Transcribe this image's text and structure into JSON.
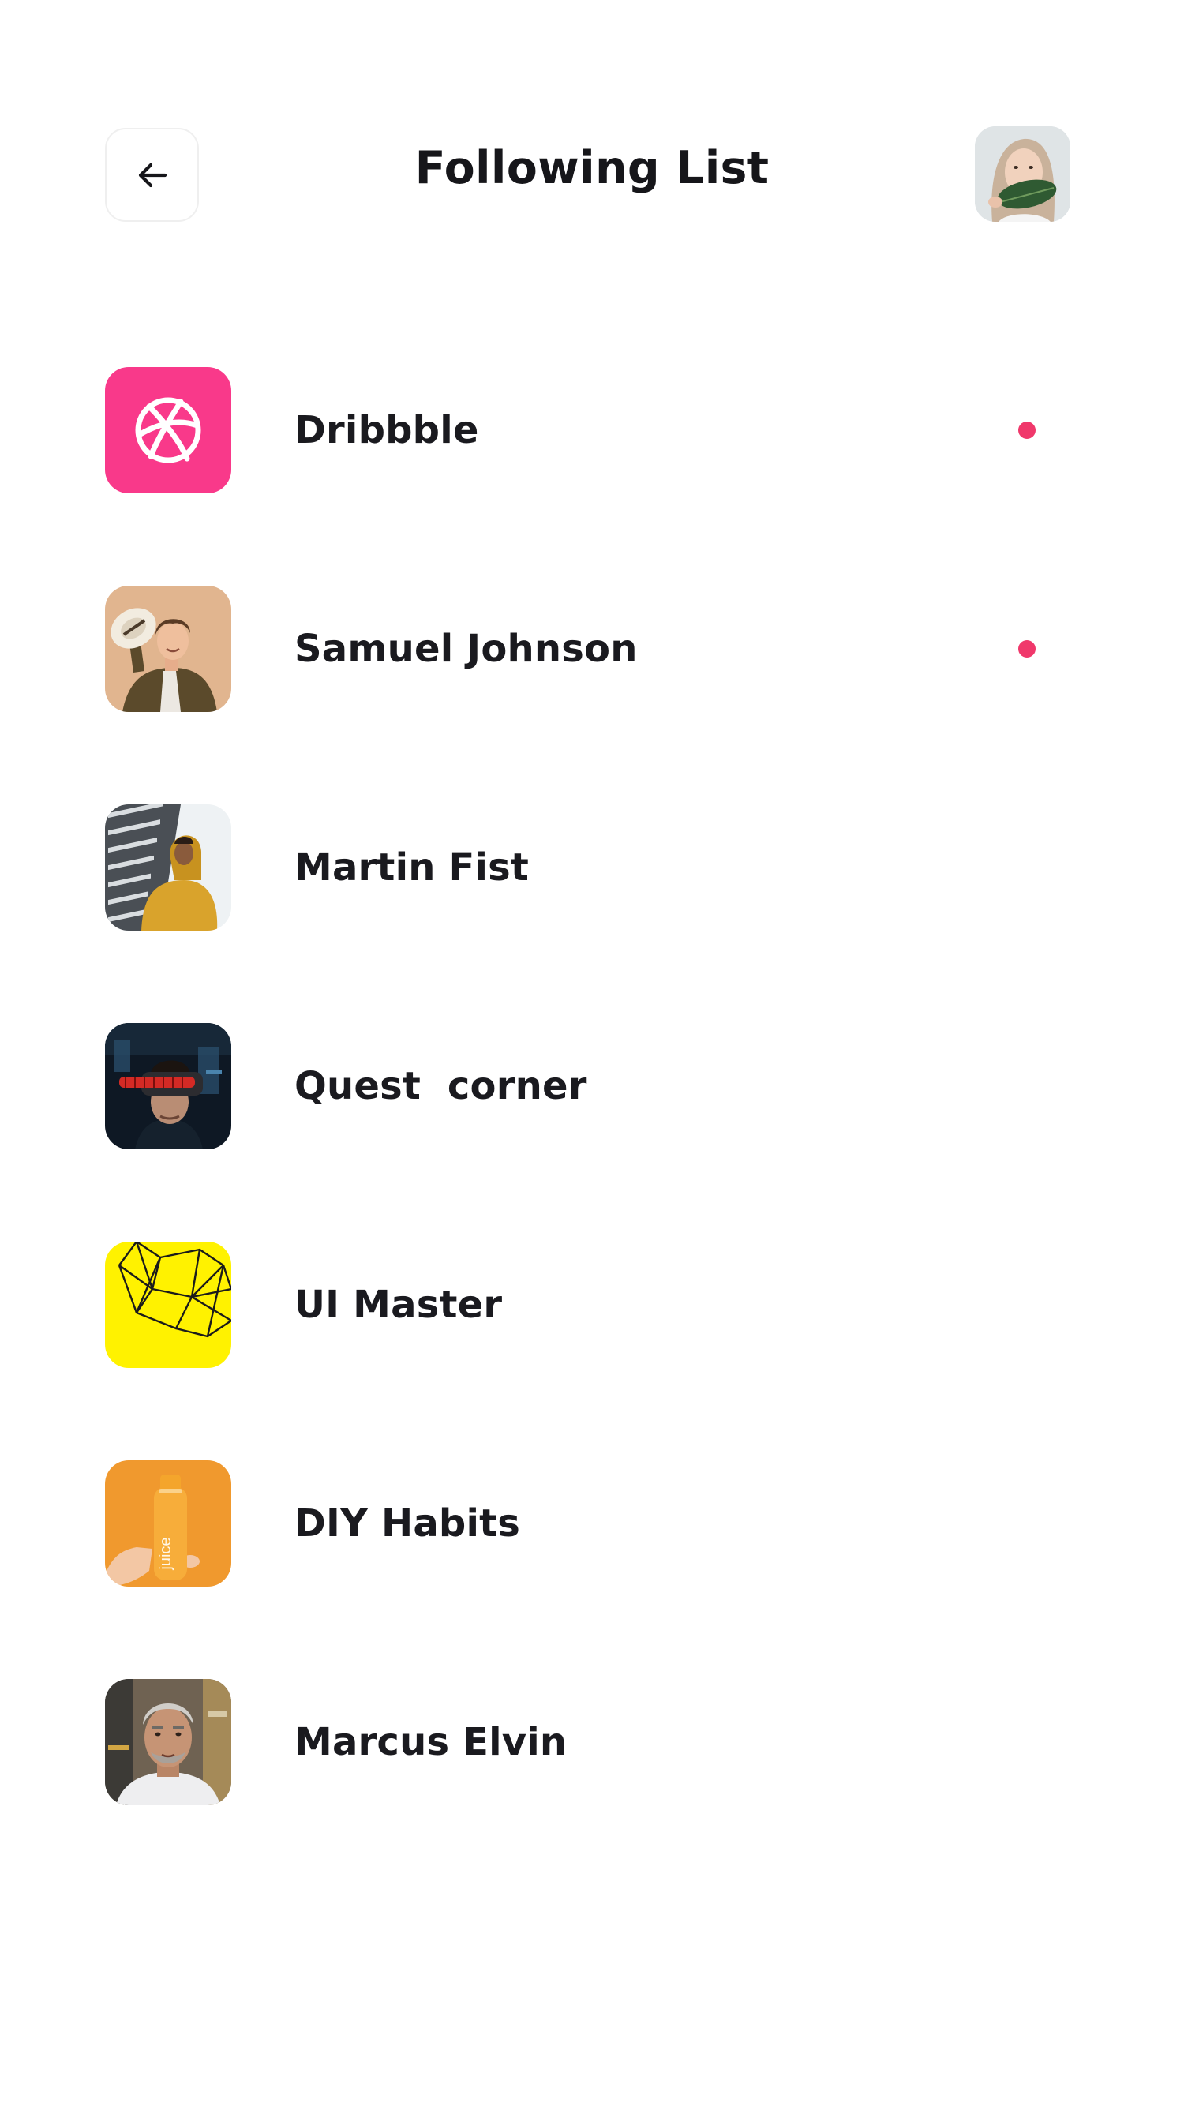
{
  "header": {
    "title": "Following List",
    "back_icon": "arrow-left-icon",
    "profile_avatar": "user-avatar"
  },
  "accent_color": "#f0386b",
  "following": [
    {
      "name": "Dribbble",
      "avatar": "dribbble-icon",
      "unread": true
    },
    {
      "name": "Samuel Johnson",
      "avatar": "photo-man-with-hat",
      "unread": true
    },
    {
      "name": "Martin Fist",
      "avatar": "photo-man-yellow-hoodie",
      "unread": false
    },
    {
      "name": "Quest  corner",
      "avatar": "photo-vr-headset",
      "unread": false
    },
    {
      "name": "UI Master",
      "avatar": "yellow-geometric",
      "unread": false
    },
    {
      "name": "DIY Habits",
      "avatar": "juice-bottle",
      "unread": false
    },
    {
      "name": "Marcus Elvin",
      "avatar": "photo-older-man",
      "unread": false
    }
  ],
  "juice_label": "juice"
}
